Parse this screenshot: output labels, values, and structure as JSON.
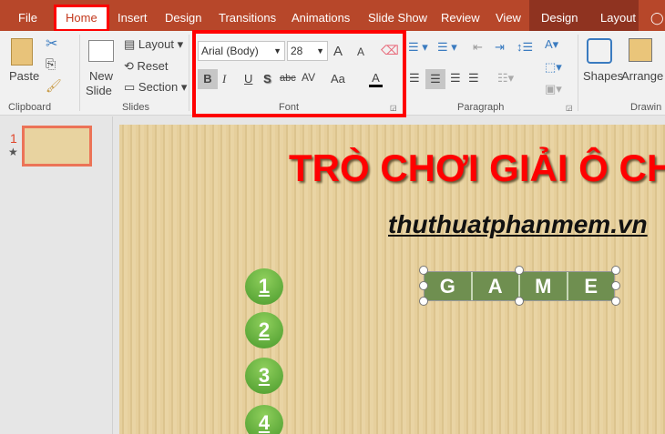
{
  "tabs": [
    "File",
    "Home",
    "Insert",
    "Design",
    "Transitions",
    "Animations",
    "Slide Show",
    "Review",
    "View",
    "Design",
    "Layout"
  ],
  "ribbon": {
    "clipboard": {
      "paste": "Paste",
      "group": "Clipboard"
    },
    "slides": {
      "new_slide_line1": "New",
      "new_slide_line2": "Slide",
      "layout": "Layout",
      "reset": "Reset",
      "section": "Section",
      "group": "Slides"
    },
    "font": {
      "font_name": "Arial (Body)",
      "font_size": "28",
      "bold": "B",
      "italic": "I",
      "underline": "U",
      "shadow": "S",
      "strike": "abc",
      "spacing": "AV",
      "case": "Aa",
      "color": "A",
      "grow": "A",
      "shrink": "A",
      "group": "Font"
    },
    "paragraph": {
      "group": "Paragraph"
    },
    "drawing": {
      "shapes": "Shapes",
      "arrange": "Arrange",
      "group": "Drawin"
    }
  },
  "slide_pane": {
    "slide_number": "1"
  },
  "slide": {
    "title": "TRÒ CHƠI GIẢI Ô CHỮ",
    "subtitle": "thuthuatphanmem.vn",
    "numbers": [
      "1",
      "2",
      "3",
      "4"
    ],
    "game_letters": [
      "G",
      "A",
      "M",
      "E"
    ]
  }
}
